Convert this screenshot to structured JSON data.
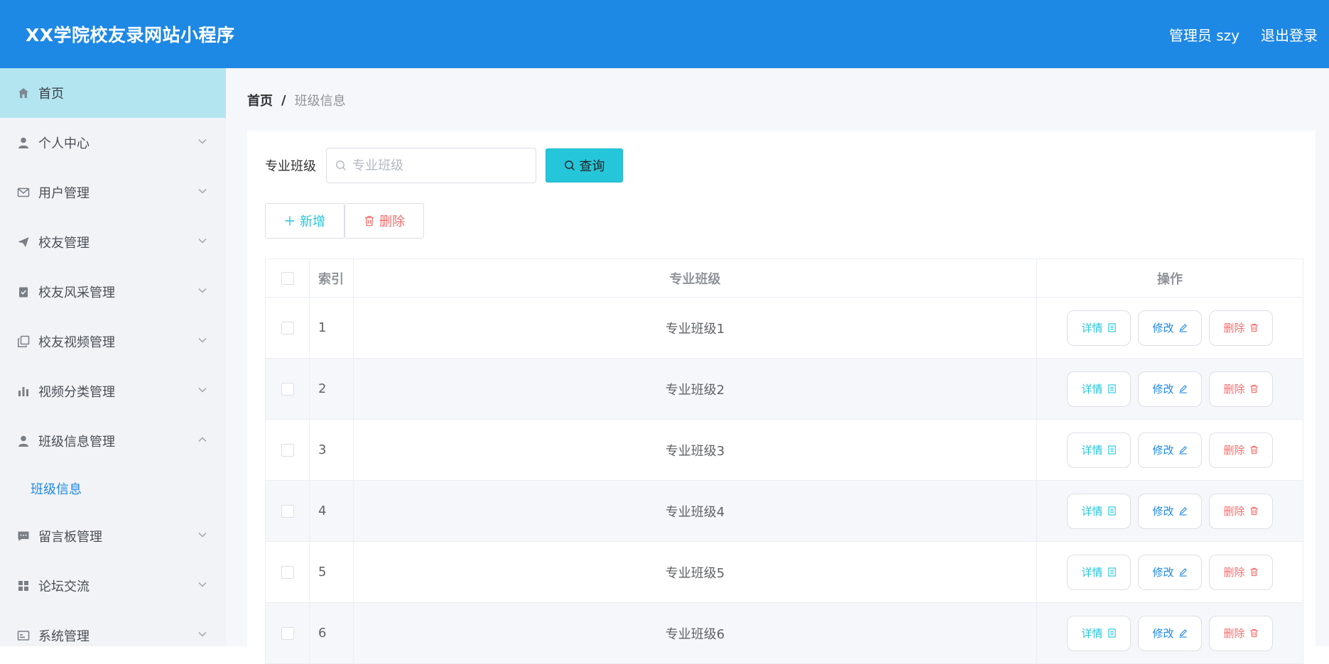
{
  "header": {
    "title": "XX学院校友录网站小程序",
    "user": "管理员 szy",
    "logout": "退出登录"
  },
  "sidebar": {
    "items": [
      {
        "label": "首页",
        "icon": "home-icon",
        "active": true,
        "expandable": false
      },
      {
        "label": "个人中心",
        "icon": "user-icon",
        "expandable": true
      },
      {
        "label": "用户管理",
        "icon": "mail-icon",
        "expandable": true
      },
      {
        "label": "校友管理",
        "icon": "send-icon",
        "expandable": true
      },
      {
        "label": "校友风采管理",
        "icon": "clipboard-icon",
        "expandable": true
      },
      {
        "label": "校友视频管理",
        "icon": "copy-icon",
        "expandable": true
      },
      {
        "label": "视频分类管理",
        "icon": "bar-chart-icon",
        "expandable": true
      },
      {
        "label": "班级信息管理",
        "icon": "user-icon",
        "expandable": true,
        "expanded": true
      },
      {
        "label": "留言板管理",
        "icon": "message-icon",
        "expandable": true
      },
      {
        "label": "论坛交流",
        "icon": "grid-icon",
        "expandable": true
      },
      {
        "label": "系统管理",
        "icon": "system-icon",
        "expandable": true
      }
    ],
    "sub_item": "班级信息"
  },
  "breadcrumb": {
    "home": "首页",
    "separator": "/",
    "current": "班级信息"
  },
  "search": {
    "label": "专业班级",
    "placeholder": "专业班级",
    "button": "查询"
  },
  "actions": {
    "add": "新增",
    "delete": "删除"
  },
  "table": {
    "headers": {
      "index": "索引",
      "name": "专业班级",
      "ops": "操作"
    },
    "rows": [
      {
        "index": "1",
        "name": "专业班级1"
      },
      {
        "index": "2",
        "name": "专业班级2"
      },
      {
        "index": "3",
        "name": "专业班级3"
      },
      {
        "index": "4",
        "name": "专业班级4"
      },
      {
        "index": "5",
        "name": "专业班级5"
      },
      {
        "index": "6",
        "name": "专业班级6"
      }
    ],
    "op_labels": {
      "detail": "详情",
      "edit": "修改",
      "delete": "删除"
    }
  },
  "colors": {
    "header_bg": "#1e88e5",
    "active_nav_bg": "#b3e5f0",
    "accent_cyan": "#26c6da",
    "edit_blue": "#1e88e5",
    "danger_red": "#f56c6c"
  }
}
